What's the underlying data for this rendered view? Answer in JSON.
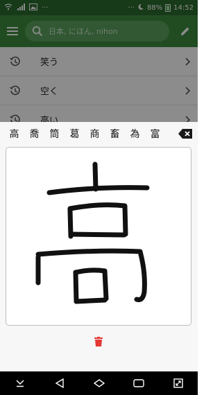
{
  "status_bar": {
    "dots": "···",
    "battery_percent": "88%",
    "time": "14:52"
  },
  "toolbar": {
    "search_placeholder": "日本, にほん, nihon"
  },
  "history": [
    {
      "label": "笑う"
    },
    {
      "label": "空く"
    },
    {
      "label": "高い"
    }
  ],
  "handwriting": {
    "candidates": [
      "高",
      "喬",
      "筒",
      "葛",
      "商",
      "畜",
      "為",
      "富"
    ]
  },
  "colors": {
    "status_bar": "#2b6a2e",
    "toolbar": "#3c8b3f",
    "search_bg": "#5aa05c",
    "trash": "#e53935"
  }
}
